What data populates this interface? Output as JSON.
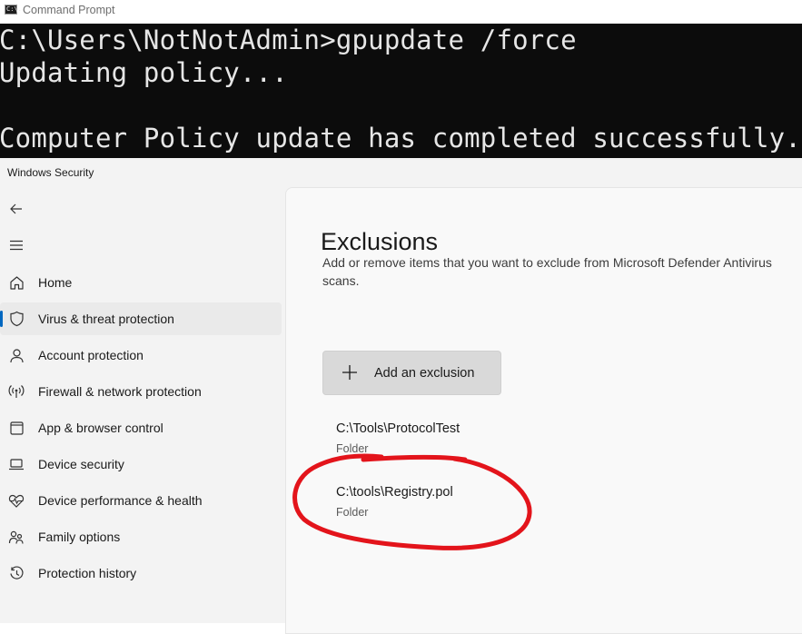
{
  "cmd": {
    "title": "Command Prompt",
    "icon_text": "C:\\.",
    "lines": [
      "C:\\Users\\NotNotAdmin>gpupdate /force",
      "Updating policy...",
      "",
      "Computer Policy update has completed successfully."
    ]
  },
  "security": {
    "title": "Windows Security",
    "nav": [
      {
        "label": "Home",
        "icon": "home-icon"
      },
      {
        "label": "Virus & threat protection",
        "icon": "shield-icon",
        "selected": true
      },
      {
        "label": "Account protection",
        "icon": "person-icon"
      },
      {
        "label": "Firewall & network protection",
        "icon": "wifi-antenna-icon"
      },
      {
        "label": "App & browser control",
        "icon": "app-window-icon"
      },
      {
        "label": "Device security",
        "icon": "laptop-icon"
      },
      {
        "label": "Device performance & health",
        "icon": "heart-pulse-icon"
      },
      {
        "label": "Family options",
        "icon": "family-icon"
      },
      {
        "label": "Protection history",
        "icon": "history-icon"
      }
    ],
    "page": {
      "title": "Exclusions",
      "description": "Add or remove items that you want to exclude from Microsoft Defender Antivirus scans.",
      "add_button_label": "Add an exclusion",
      "exclusions": [
        {
          "path": "C:\\Tools\\ProtocolTest",
          "type": "Folder"
        },
        {
          "path": "C:\\tools\\Registry.pol",
          "type": "Folder"
        }
      ]
    }
  },
  "colors": {
    "console_bg": "#0c0c0c",
    "console_text": "#e6e6e6",
    "accent": "#0067c0",
    "annotation": "#e3141b"
  }
}
